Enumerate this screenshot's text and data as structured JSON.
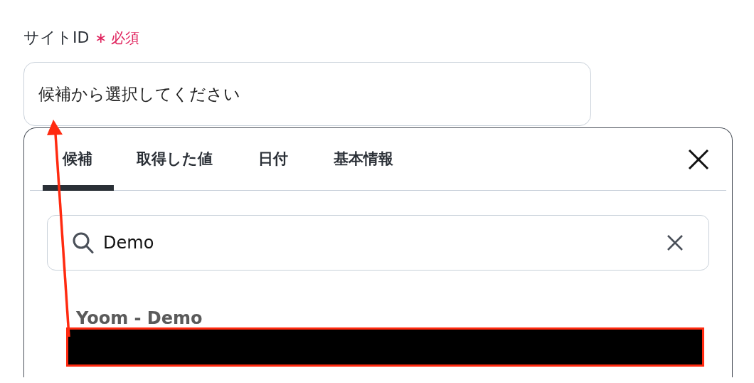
{
  "field": {
    "label": "サイトID",
    "required_mark": "∗",
    "required_text": "必須",
    "placeholder": "候補から選択してください"
  },
  "tabs": [
    {
      "label": "候補",
      "selected": true
    },
    {
      "label": "取得した値",
      "selected": false
    },
    {
      "label": "日付",
      "selected": false
    },
    {
      "label": "基本情報",
      "selected": false
    }
  ],
  "search": {
    "value": "Demo"
  },
  "options": [
    {
      "label": "Yoom - Demo",
      "redacted": true
    }
  ],
  "annotation_arrow": true
}
